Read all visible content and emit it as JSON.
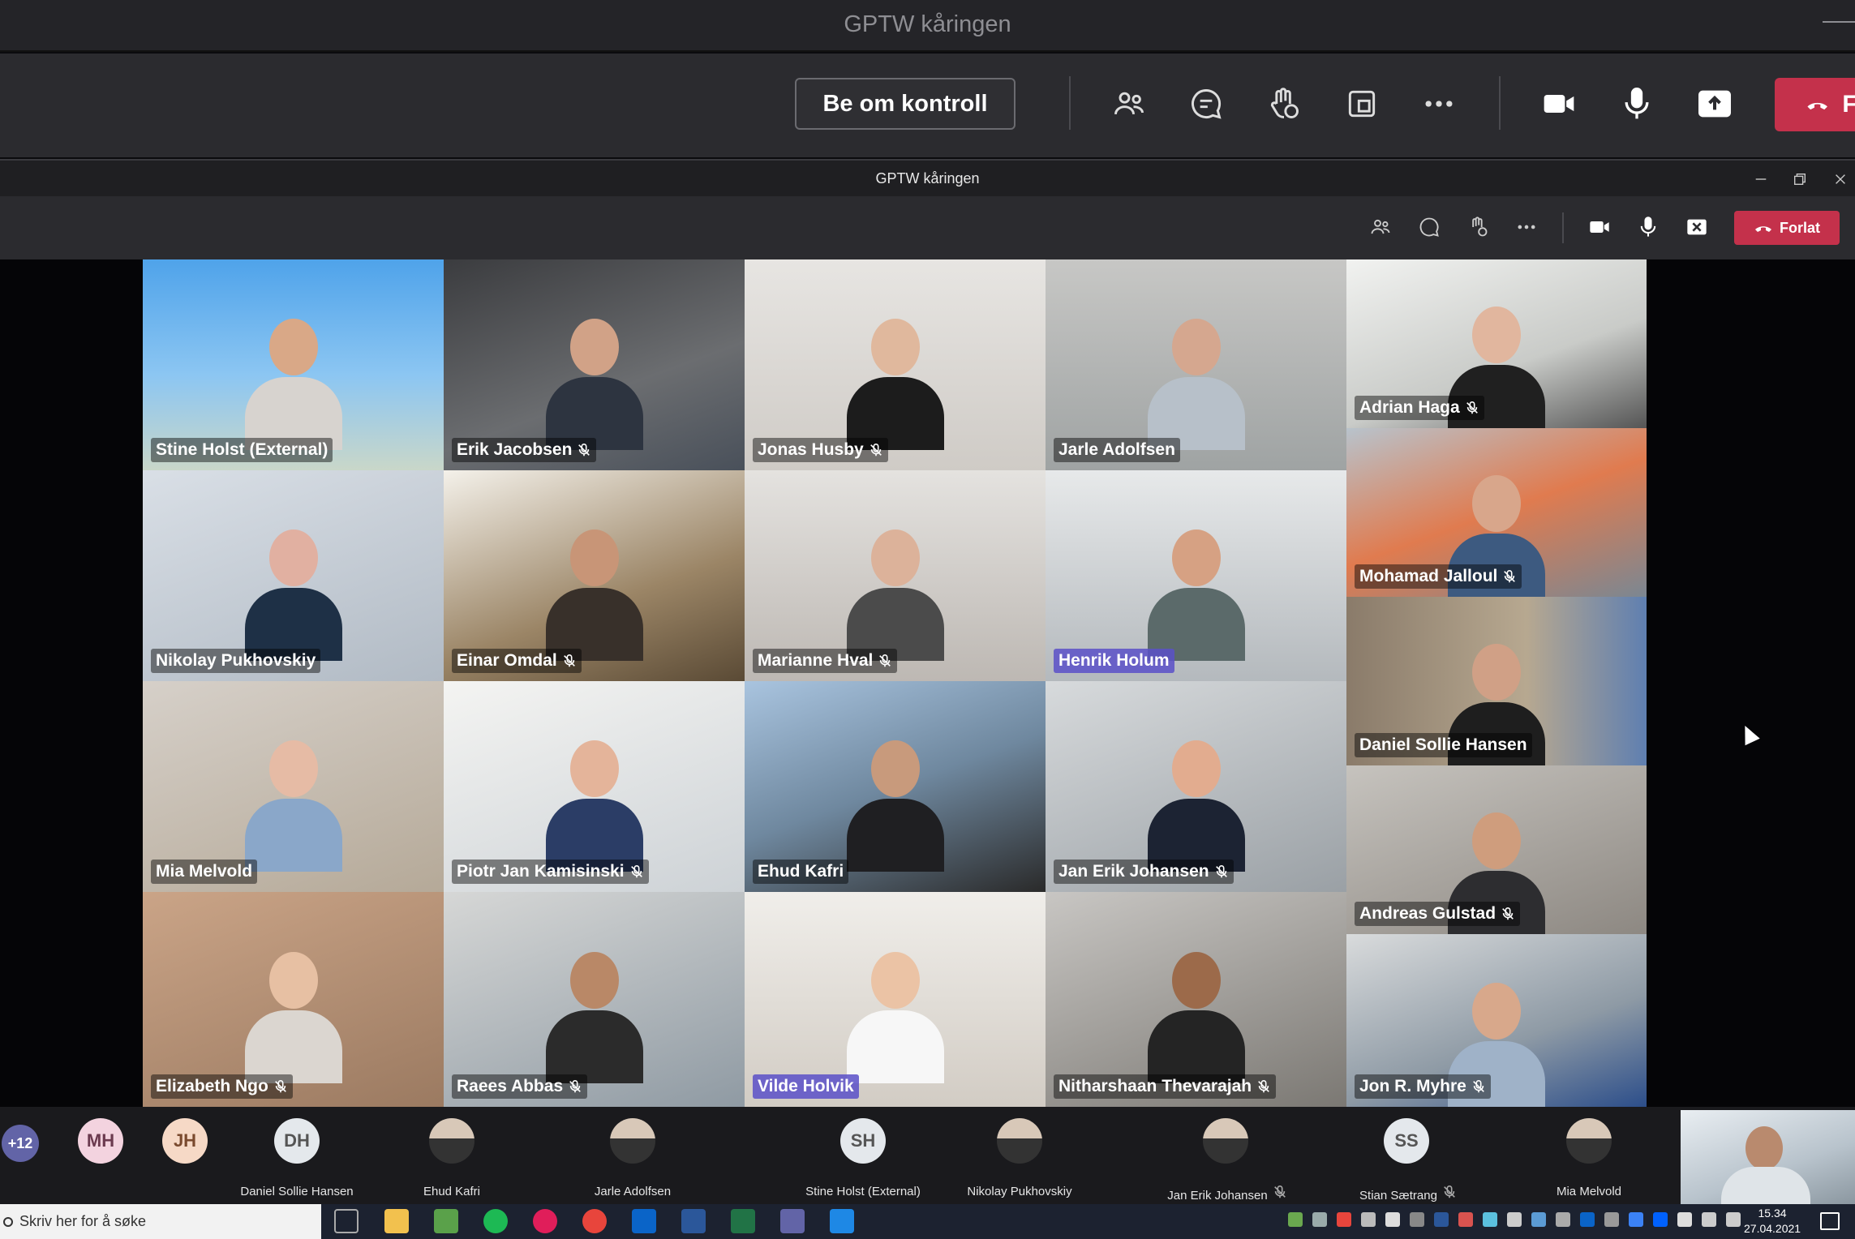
{
  "outer_window": {
    "title": "GPTW kåringen"
  },
  "outer_toolbar": {
    "control_button": "Be om kontroll",
    "leave_label": "Fo"
  },
  "inner_window": {
    "title": "GPTW kåringen"
  },
  "inner_toolbar": {
    "leave_label": "Forlat"
  },
  "tiles": [
    {
      "name": "Stine Holst (External)",
      "muted": false,
      "highlight": false
    },
    {
      "name": "Erik Jacobsen",
      "muted": true,
      "highlight": false
    },
    {
      "name": "Jonas Husby",
      "muted": true,
      "highlight": false
    },
    {
      "name": "Jarle Adolfsen",
      "muted": false,
      "highlight": false
    },
    {
      "name": "Adrian Haga",
      "muted": true,
      "highlight": false
    },
    {
      "name": "Nikolay Pukhovskiy",
      "muted": false,
      "highlight": false
    },
    {
      "name": "Einar Omdal",
      "muted": true,
      "highlight": false
    },
    {
      "name": "Marianne Hval",
      "muted": true,
      "highlight": false
    },
    {
      "name": "Henrik Holum",
      "muted": false,
      "highlight": true
    },
    {
      "name": "Mohamad Jalloul",
      "muted": true,
      "highlight": false
    },
    {
      "name": "Daniel Sollie Hansen",
      "muted": false,
      "highlight": false
    },
    {
      "name": "Mia Melvold",
      "muted": false,
      "highlight": false
    },
    {
      "name": "Piotr Jan Kamisinski",
      "muted": true,
      "highlight": false
    },
    {
      "name": "Ehud Kafri",
      "muted": false,
      "highlight": false
    },
    {
      "name": "Jan Erik Johansen",
      "muted": true,
      "highlight": false
    },
    {
      "name": "Andreas Gulstad",
      "muted": true,
      "highlight": false
    },
    {
      "name": "Elizabeth Ngo",
      "muted": true,
      "highlight": false
    },
    {
      "name": "Raees Abbas",
      "muted": true,
      "highlight": false
    },
    {
      "name": "Vilde Holvik",
      "muted": false,
      "highlight": true
    },
    {
      "name": "Nitharshaan Thevarajah",
      "muted": true,
      "highlight": false
    },
    {
      "name": "Jon R. Myhre",
      "muted": true,
      "highlight": false
    }
  ],
  "strip": {
    "overflow": "+12",
    "initials": [
      "MH",
      "JH"
    ],
    "people": [
      {
        "initials": "DH",
        "label": "Daniel Sollie Hansen",
        "muted": false
      },
      {
        "initials": "",
        "label": "Ehud Kafri",
        "muted": false
      },
      {
        "initials": "",
        "label": "Jarle Adolfsen",
        "muted": false
      },
      {
        "initials": "SH",
        "label": "Stine Holst (External)",
        "muted": false
      },
      {
        "initials": "",
        "label": "Nikolay Pukhovskiy",
        "muted": false
      },
      {
        "initials": "",
        "label": "Jan Erik Johansen",
        "muted": true
      },
      {
        "initials": "SS",
        "label": "Stian Sætrang",
        "muted": true
      },
      {
        "initials": "",
        "label": "Mia Melvold",
        "muted": false
      }
    ]
  },
  "taskbar": {
    "search_placeholder": "Skriv her for å søke",
    "time": "15.34",
    "date": "27.04.2021"
  }
}
